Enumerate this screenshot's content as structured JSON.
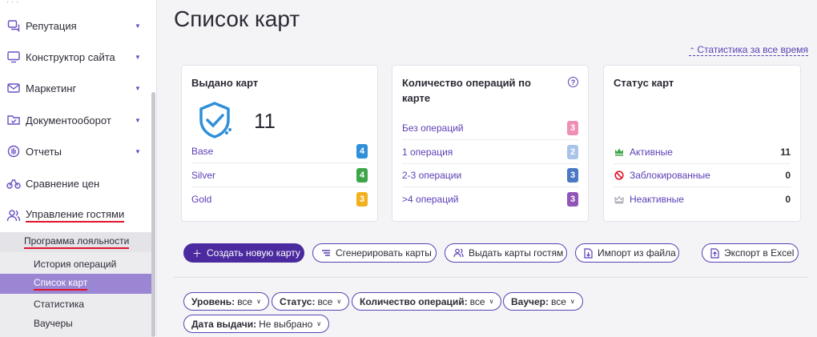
{
  "sidebar": {
    "items": [
      {
        "label": "Репутация",
        "icon": "chat-icon"
      },
      {
        "label": "Конструктор сайта",
        "icon": "monitor-icon"
      },
      {
        "label": "Маркетинг",
        "icon": "mail-icon"
      },
      {
        "label": "Документооборот",
        "icon": "folder-check-icon"
      },
      {
        "label": "Отчеты",
        "icon": "pie-chart-icon"
      },
      {
        "label": "Сравнение цен",
        "icon": "scales-icon"
      },
      {
        "label": "Управление гостями",
        "icon": "users-icon"
      }
    ],
    "sub_items": [
      {
        "label": "Программа лояльности"
      },
      {
        "label": "История операций"
      },
      {
        "label": "Список карт"
      },
      {
        "label": "Статистика"
      },
      {
        "label": "Ваучеры"
      }
    ]
  },
  "page": {
    "title": "Список карт",
    "stats_link": "Статистика за все время"
  },
  "cards": {
    "issued": {
      "title": "Выдано карт",
      "total": "11",
      "rows": [
        {
          "label": "Base",
          "value": "4",
          "color": "#2f8fd8"
        },
        {
          "label": "Silver",
          "value": "4",
          "color": "#3fa54a"
        },
        {
          "label": "Gold",
          "value": "3",
          "color": "#f2b01e"
        }
      ]
    },
    "operations": {
      "title": "Количество операций по карте",
      "help": "?",
      "rows": [
        {
          "label": "Без операций",
          "value": "3",
          "color": "#ee8fb4"
        },
        {
          "label": "1 операция",
          "value": "2",
          "color": "#a9c4e8"
        },
        {
          "label": "2-3 операции",
          "value": "3",
          "color": "#4a78c2"
        },
        {
          "label": ">4 операций",
          "value": "3",
          "color": "#8f55b8"
        }
      ]
    },
    "status": {
      "title": "Статус карт",
      "rows": [
        {
          "label": "Активные",
          "value": "11",
          "icon": "crown-green-icon"
        },
        {
          "label": "Заблокированные",
          "value": "0",
          "icon": "blocked-icon"
        },
        {
          "label": "Неактивные",
          "value": "0",
          "icon": "crown-gray-icon"
        }
      ]
    }
  },
  "actions": {
    "create": "Создать новую карту",
    "generate": "Сгенерировать карты",
    "issue": "Выдать карты гостям",
    "import": "Импорт из файла",
    "export": "Экспорт в Excel"
  },
  "filters": {
    "level": {
      "label": "Уровень:",
      "value": "все"
    },
    "status": {
      "label": "Статус:",
      "value": "все"
    },
    "ops": {
      "label": "Количество операций:",
      "value": "все"
    },
    "voucher": {
      "label": "Ваучер:",
      "value": "все"
    },
    "date": {
      "label": "Дата выдачи:",
      "value": "Не выбрано"
    }
  }
}
